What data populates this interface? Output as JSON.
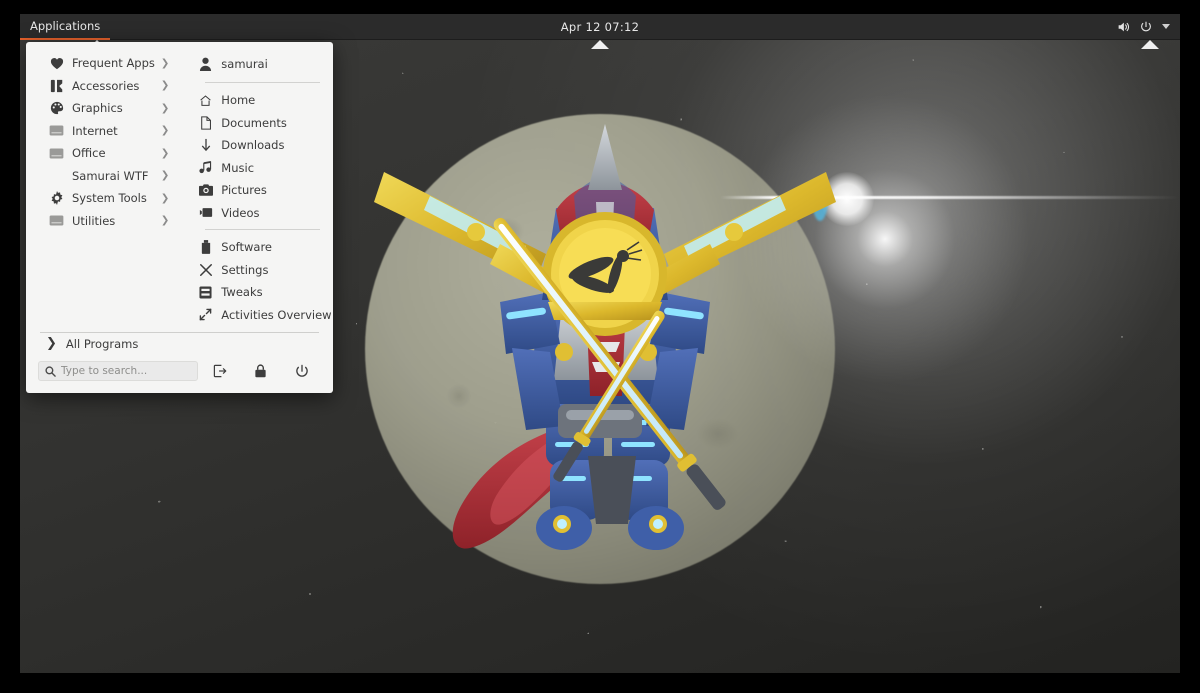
{
  "topbar": {
    "applications_label": "Applications",
    "clock": "Apr 12  07:12",
    "tray": [
      {
        "name": "volume-icon",
        "label": "volume-icon"
      },
      {
        "name": "power-icon",
        "label": "power-icon"
      },
      {
        "name": "chevron-down-icon",
        "label": "chevron-down-icon"
      }
    ],
    "accent_color": "#e8622c",
    "background_color": "#2b2b2b"
  },
  "menu": {
    "background_color": "#f5f5f4",
    "categories": [
      {
        "label": "Frequent Apps",
        "icon": "heart-icon",
        "has_submenu": true
      },
      {
        "label": "Accessories",
        "icon": "accessories-icon",
        "has_submenu": true
      },
      {
        "label": "Graphics",
        "icon": "palette-icon",
        "has_submenu": true
      },
      {
        "label": "Internet",
        "icon": "folder-icon",
        "has_submenu": true
      },
      {
        "label": "Office",
        "icon": "folder-icon",
        "has_submenu": true
      },
      {
        "label": "Samurai WTF",
        "icon": "none",
        "has_submenu": true
      },
      {
        "label": "System Tools",
        "icon": "gear-icon",
        "has_submenu": true
      },
      {
        "label": "Utilities",
        "icon": "folder-icon",
        "has_submenu": true
      }
    ],
    "user": {
      "name": "samurai",
      "icon": "user-icon"
    },
    "places": [
      {
        "label": "Home",
        "icon": "home-icon"
      },
      {
        "label": "Documents",
        "icon": "document-icon"
      },
      {
        "label": "Downloads",
        "icon": "download-icon"
      },
      {
        "label": "Music",
        "icon": "music-icon"
      },
      {
        "label": "Pictures",
        "icon": "camera-icon"
      },
      {
        "label": "Videos",
        "icon": "video-icon"
      }
    ],
    "system": [
      {
        "label": "Software",
        "icon": "software-icon"
      },
      {
        "label": "Settings",
        "icon": "settings-icon"
      },
      {
        "label": "Tweaks",
        "icon": "tweaks-icon"
      },
      {
        "label": "Activities Overview",
        "icon": "activities-icon"
      }
    ],
    "all_programs_label": "All Programs",
    "search": {
      "placeholder": "Type to search...",
      "value": "",
      "icon": "search-icon"
    },
    "footer_actions": [
      {
        "name": "logout-button",
        "label": "logout-icon"
      },
      {
        "name": "lock-button",
        "label": "lock-icon"
      },
      {
        "name": "power-button",
        "label": "power-icon"
      }
    ]
  },
  "desktop": {
    "wallpaper_name": "samurai-mech-moon-wallpaper",
    "colors": {
      "sky": "#2e2e2e",
      "moon": "#a9a996",
      "armor_blue": "#3f5fa8",
      "armor_red": "#b3333a",
      "armor_gold": "#e0bf33",
      "armor_silver": "#b7bcc2",
      "glow_cyan": "#8fe3ff"
    }
  }
}
